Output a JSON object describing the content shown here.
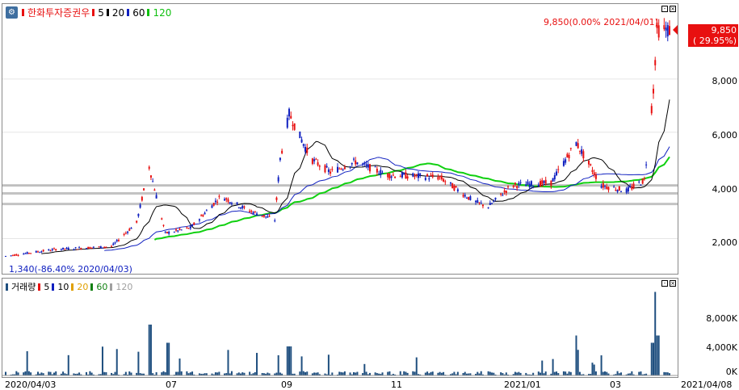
{
  "price_legend": {
    "icon": "gear-icon",
    "stock_name": "한화투자증권우",
    "ma": [
      {
        "label": "5",
        "color": "#e81010"
      },
      {
        "label": "20",
        "color": "#000000"
      },
      {
        "label": "60",
        "color": "#1020c0"
      },
      {
        "label": "120",
        "color": "#10c010"
      }
    ]
  },
  "volume_legend": {
    "title": "거래량",
    "ma": [
      {
        "label": "5",
        "color": "#e81010"
      },
      {
        "label": "10",
        "color": "#1020c0"
      },
      {
        "label": "20",
        "color": "#e0a000"
      },
      {
        "label": "60",
        "color": "#108010"
      },
      {
        "label": "120",
        "color": "#a0a0a0"
      }
    ]
  },
  "annotations": {
    "high_label": "9,850(0.00% 2021/04/01)",
    "low_label": "1,340(-86.40% 2020/04/03)"
  },
  "current_price": {
    "price": "9,850",
    "change": "( 29.95%)"
  },
  "price_axis": [
    "8,000",
    "6,000",
    "4,000",
    "2,000"
  ],
  "volume_axis": [
    "8,000K",
    "4,000K",
    "0K"
  ],
  "x_axis": [
    "2020/04/03",
    "07",
    "09",
    "11",
    "2021/01",
    "03",
    "2021/04/08"
  ],
  "colors": {
    "up": "#e81010",
    "down": "#1020c0",
    "grid": "#b0b0b0",
    "volume": "#1f4f7f"
  },
  "chart_data": {
    "type": "candlestick",
    "x_range": [
      "2020/04/03",
      "2021/04/08"
    ],
    "y_range": [
      800,
      10700
    ],
    "horizontal_levels": [
      4000,
      3700,
      3300
    ],
    "price_points": [
      {
        "date": "2020/04/03",
        "close": 1340
      },
      {
        "date": "2020/05/01",
        "close": 1600
      },
      {
        "date": "2020/06/01",
        "close": 1700
      },
      {
        "date": "2020/06/15",
        "close": 2600
      },
      {
        "date": "2020/06/22",
        "close": 4700
      },
      {
        "date": "2020/07/01",
        "close": 2200
      },
      {
        "date": "2020/07/15",
        "close": 2400
      },
      {
        "date": "2020/08/01",
        "close": 3600
      },
      {
        "date": "2020/08/15",
        "close": 3100
      },
      {
        "date": "2020/08/31",
        "close": 2700
      },
      {
        "date": "2020/09/03",
        "close": 5000
      },
      {
        "date": "2020/09/08",
        "close": 6700
      },
      {
        "date": "2020/09/20",
        "close": 5000
      },
      {
        "date": "2020/10/01",
        "close": 4500
      },
      {
        "date": "2020/10/15",
        "close": 4900
      },
      {
        "date": "2020/11/01",
        "close": 4400
      },
      {
        "date": "2020/12/01",
        "close": 4300
      },
      {
        "date": "2020/12/20",
        "close": 3400
      },
      {
        "date": "2020/12/28",
        "close": 3200
      },
      {
        "date": "2021/01/10",
        "close": 4000
      },
      {
        "date": "2021/02/01",
        "close": 4100
      },
      {
        "date": "2021/02/15",
        "close": 5600
      },
      {
        "date": "2021/03/01",
        "close": 4000
      },
      {
        "date": "2021/03/15",
        "close": 3800
      },
      {
        "date": "2021/03/25",
        "close": 4200
      },
      {
        "date": "2021/03/30",
        "close": 7600
      },
      {
        "date": "2021/04/01",
        "close": 9850
      },
      {
        "date": "2021/04/08",
        "close": 9850
      }
    ],
    "volume_range": [
      0,
      12000
    ],
    "volume_spikes": [
      {
        "date": "2020/06/22",
        "value": 7000
      },
      {
        "date": "2020/07/03",
        "value": 4500
      },
      {
        "date": "2020/09/08",
        "value": 4000
      },
      {
        "date": "2021/02/15",
        "value": 5500
      },
      {
        "date": "2021/03/30",
        "value": 4500
      },
      {
        "date": "2021/04/01",
        "value": 11500
      },
      {
        "date": "2021/04/02",
        "value": 5500
      }
    ]
  }
}
